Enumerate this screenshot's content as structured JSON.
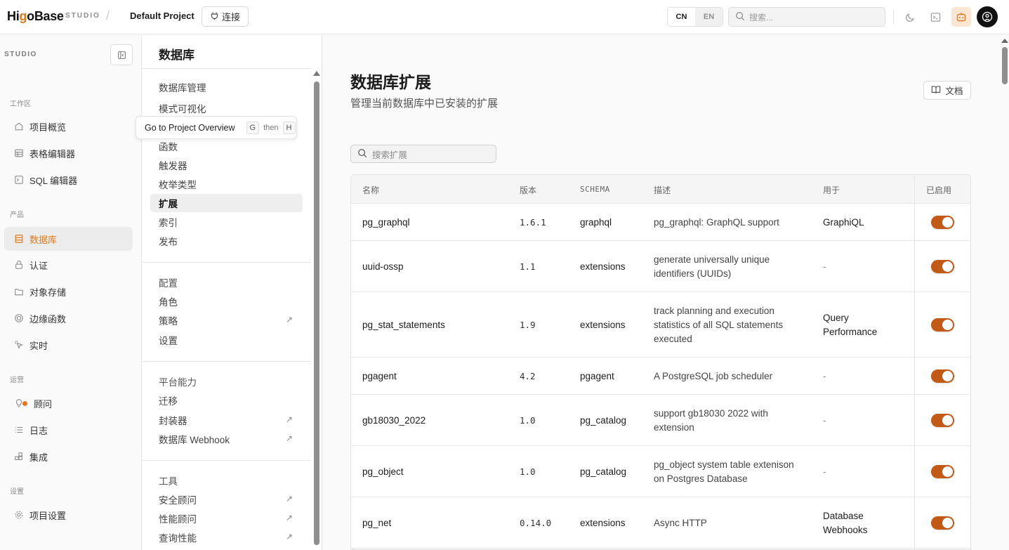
{
  "topbar": {
    "logo_pre": "Hi",
    "logo_o1": "g",
    "logo_mid": "o",
    "logo_post": "Base",
    "studio": "STUDIO",
    "separator": "/",
    "project": "Default Project",
    "connect_label": "连接",
    "lang_cn": "CN",
    "lang_en": "EN",
    "search_placeholder": "搜索..."
  },
  "sidebar": {
    "header": "STUDIO",
    "groups": {
      "workspace": "工作区",
      "product": "产品",
      "operations": "运营",
      "settings": "设置"
    },
    "items": {
      "overview": "项目概览",
      "table_editor": "表格编辑器",
      "sql_editor": "SQL 编辑器",
      "database": "数据库",
      "auth": "认证",
      "storage": "对象存储",
      "edge_functions": "边缘函数",
      "realtime": "实时",
      "advisor": "顾问",
      "logs": "日志",
      "integrations": "集成",
      "project_settings": "项目设置"
    }
  },
  "panel": {
    "title": "数据库",
    "items": {
      "db_manage": "数据库管理",
      "schema_viz": "模式可视化",
      "functions": "函数",
      "triggers": "触发器",
      "enum_types": "枚举类型",
      "extensions": "扩展",
      "indexes": "索引",
      "publications": "发布",
      "config": "配置",
      "roles": "角色",
      "policies": "策略",
      "settings": "设置",
      "platform": "平台能力",
      "migrations": "迁移",
      "wrappers": "封装器",
      "webhooks": "数据库 Webhook",
      "tools": "工具",
      "security_advisor": "安全顾问",
      "performance_advisor": "性能顾问",
      "query_performance": "查询性能"
    },
    "external_glyph": "↗"
  },
  "tooltip": {
    "text": "Go to Project Overview",
    "key1": "G",
    "then": "then",
    "key2": "H"
  },
  "main": {
    "title": "数据库扩展",
    "subtitle": "管理当前数据库中已安装的扩展",
    "docs_label": "文档",
    "search_placeholder": "搜索扩展"
  },
  "table": {
    "headers": {
      "name": "名称",
      "version": "版本",
      "schema": "SCHEMA",
      "description": "描述",
      "used_by": "用于",
      "enabled": "已启用"
    },
    "rows": [
      {
        "name": "pg_graphql",
        "version": "1.6.1",
        "schema": "graphql",
        "description": "pg_graphql: GraphQL support",
        "used_by": "GraphiQL",
        "enabled": true
      },
      {
        "name": "uuid-ossp",
        "version": "1.1",
        "schema": "extensions",
        "description": "generate universally unique identifiers (UUIDs)",
        "used_by": "-",
        "enabled": true
      },
      {
        "name": "pg_stat_statements",
        "version": "1.9",
        "schema": "extensions",
        "description": "track planning and execution statistics of all SQL statements executed",
        "used_by": "Query Performance",
        "enabled": true
      },
      {
        "name": "pgagent",
        "version": "4.2",
        "schema": "pgagent",
        "description": "A PostgreSQL job scheduler",
        "used_by": "-",
        "enabled": true
      },
      {
        "name": "gb18030_2022",
        "version": "1.0",
        "schema": "pg_catalog",
        "description": "support gb18030 2022 with extension",
        "used_by": "-",
        "enabled": true
      },
      {
        "name": "pg_object",
        "version": "1.0",
        "schema": "pg_catalog",
        "description": "pg_object system table extenison on Postgres Database",
        "used_by": "-",
        "enabled": true
      },
      {
        "name": "pg_net",
        "version": "0.14.0",
        "schema": "extensions",
        "description": "Async HTTP",
        "used_by": "Database Webhooks",
        "enabled": true
      }
    ]
  },
  "colors": {
    "accent": "#e07a1f",
    "toggle_on": "#c25a17"
  }
}
